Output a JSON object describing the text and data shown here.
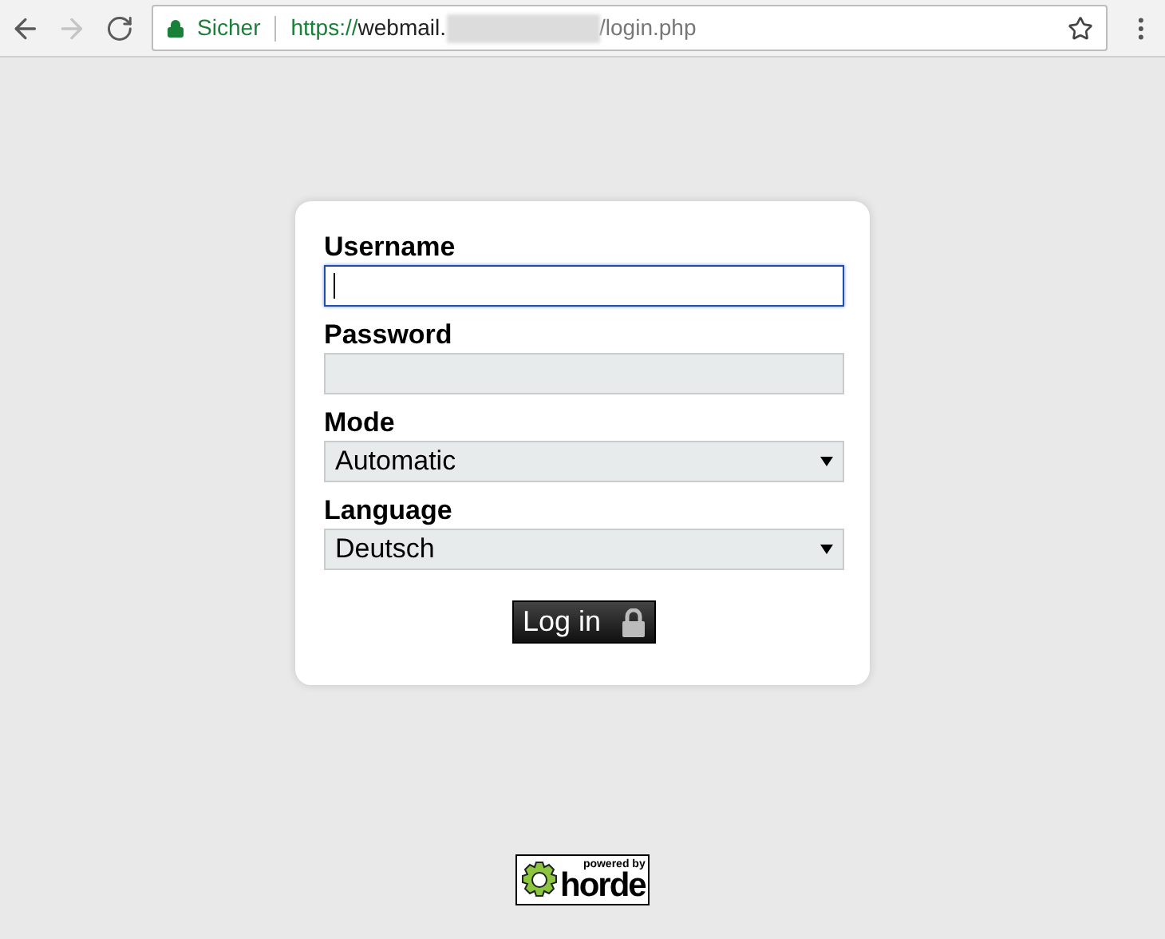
{
  "browser": {
    "security_label": "Sicher",
    "url_scheme": "https://",
    "url_host_start": "webmail.",
    "url_path": "/login.php",
    "back_enabled": true,
    "forward_enabled": false
  },
  "form": {
    "fields": [
      {
        "kind": "text",
        "label": "Username",
        "focused": true
      },
      {
        "kind": "password",
        "label": "Password",
        "focused": false
      },
      {
        "kind": "select",
        "label": "Mode",
        "value": "Automatic"
      },
      {
        "kind": "select",
        "label": "Language",
        "value": "Deutsch"
      }
    ],
    "submit": "Log in"
  },
  "footer": {
    "badge_small": "powered by",
    "badge_large": "horde"
  }
}
